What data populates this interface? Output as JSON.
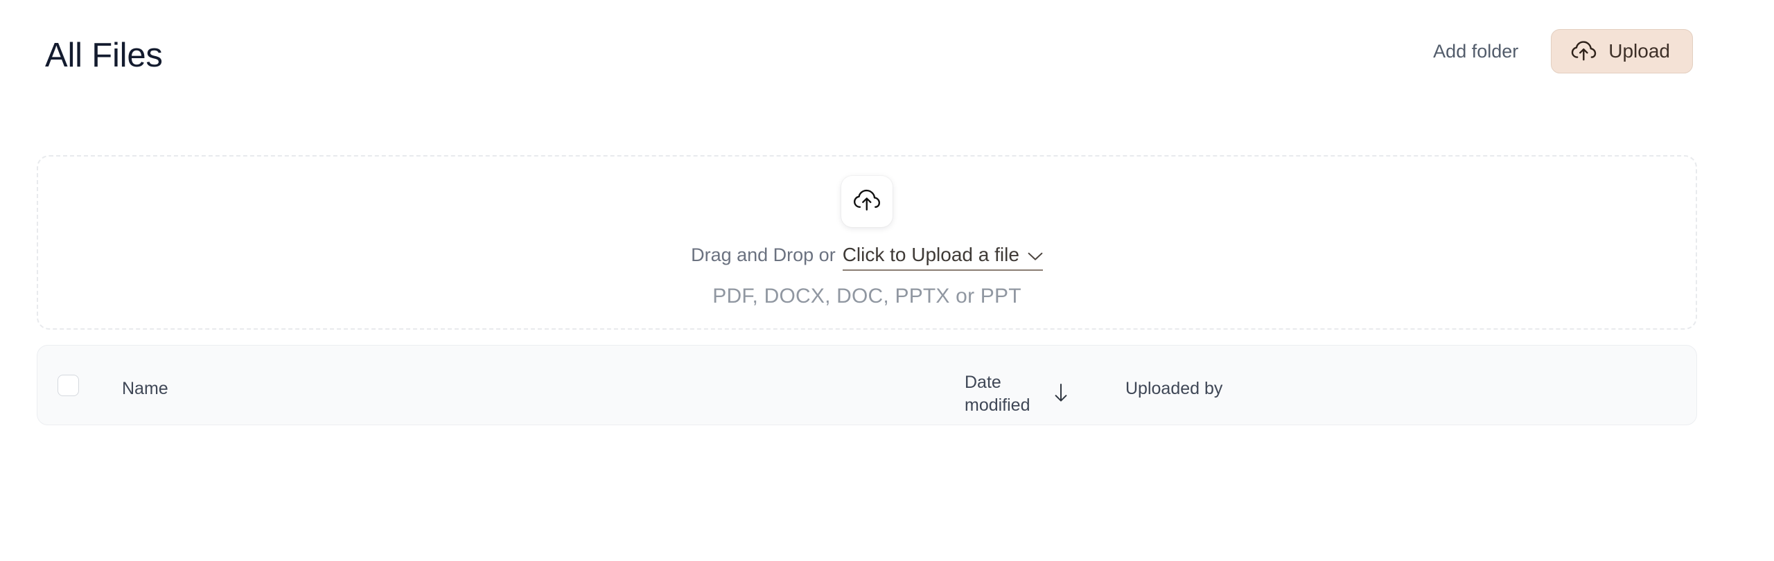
{
  "colors": {
    "page_background": "#ffffff",
    "title_text": "#131b2e",
    "upload_button_background": "#f4e2d6",
    "upload_button_border": "#e3cfc0",
    "upload_button_text": "#3d2f27",
    "add_folder_text": "#525c6b",
    "dropzone_border": "#e8eaed",
    "dropzone_muted_text": "#6b7280",
    "dropzone_cta_text": "#3f3a36",
    "dropzone_cta_underline": "#8a7d73",
    "dropzone_formats_text": "#9097a1",
    "table_header_background": "#f9fafb",
    "table_border": "#eceef1",
    "table_header_text": "#3f4756",
    "checkbox_border": "#d5d9de"
  },
  "header": {
    "title": "All Files",
    "add_folder_label": "Add folder",
    "upload_label": "Upload",
    "upload_icon": "cloud-upload-icon"
  },
  "dropzone": {
    "icon": "cloud-upload-icon",
    "prefix_text": "Drag and Drop or",
    "cta_text": "Click to Upload a file",
    "cta_icon": "chevron-down-icon",
    "formats_text": "PDF, DOCX, DOC, PPTX or PPT"
  },
  "file_table": {
    "select_all_checkbox": {
      "checked": false,
      "icon": "checkbox-unchecked-icon"
    },
    "columns": [
      {
        "key": "name",
        "label": "Name",
        "sortable": true,
        "sorted": false
      },
      {
        "key": "date_modified",
        "label": "Date modified",
        "sortable": true,
        "sorted": true,
        "sort_direction": "descending",
        "sort_icon": "arrow-down-icon"
      },
      {
        "key": "uploaded_by",
        "label": "Uploaded by",
        "sortable": true,
        "sorted": false
      }
    ],
    "rows": [],
    "row_count": 0
  }
}
